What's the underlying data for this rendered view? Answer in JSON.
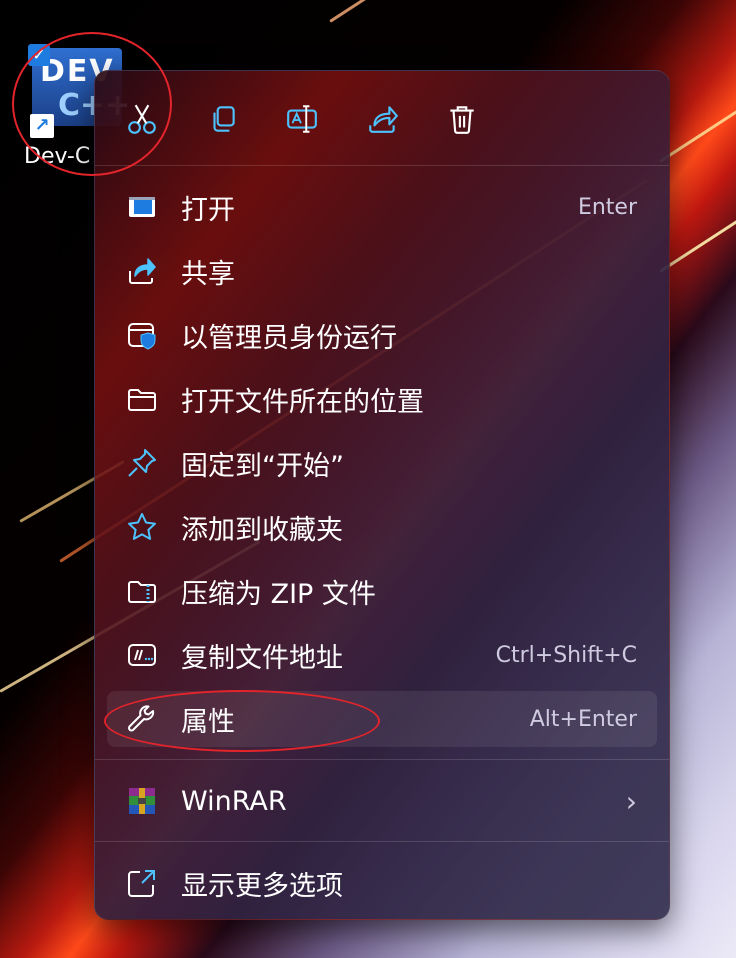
{
  "desktop": {
    "icon_label": "Dev-C",
    "icon_tile_line1": "DEV",
    "icon_tile_line2": "C++",
    "check_mark": "✓",
    "shortcut_arrow": "↗"
  },
  "toolbar": [
    {
      "name": "cut-icon"
    },
    {
      "name": "copy-icon"
    },
    {
      "name": "rename-icon"
    },
    {
      "name": "share-icon"
    },
    {
      "name": "delete-icon"
    }
  ],
  "menu": {
    "items": [
      {
        "label": "打开",
        "shortcut": "Enter",
        "icon": "app-window-icon"
      },
      {
        "label": "共享",
        "shortcut": "",
        "icon": "share-icon"
      },
      {
        "label": "以管理员身份运行",
        "shortcut": "",
        "icon": "shield-window-icon"
      },
      {
        "label": "打开文件所在的位置",
        "shortcut": "",
        "icon": "folder-icon"
      },
      {
        "label": "固定到“开始”",
        "shortcut": "",
        "icon": "pin-icon"
      },
      {
        "label": "添加到收藏夹",
        "shortcut": "",
        "icon": "star-icon"
      },
      {
        "label": "压缩为 ZIP 文件",
        "shortcut": "",
        "icon": "zip-folder-icon"
      },
      {
        "label": "复制文件地址",
        "shortcut": "Ctrl+Shift+C",
        "icon": "copy-path-icon"
      },
      {
        "label": "属性",
        "shortcut": "Alt+Enter",
        "icon": "wrench-icon"
      }
    ],
    "winrar": {
      "label": "WinRAR",
      "chevron": "›",
      "icon": "winrar-icon"
    },
    "more": {
      "label": "显示更多选项",
      "icon": "more-options-icon"
    }
  },
  "colors": {
    "accent": "#4cc2ff",
    "annotation": "#e3242b"
  }
}
